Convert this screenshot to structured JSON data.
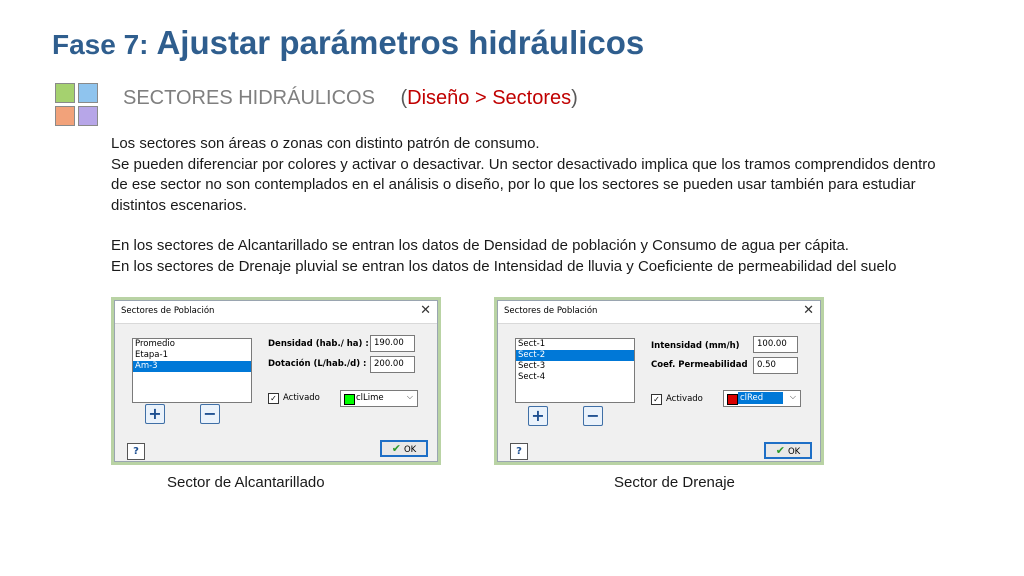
{
  "slide": {
    "title_prefix": "Fase 7:",
    "title_main": "Ajustar parámetros hidráulicos",
    "section_label": "SECTORES HIDRÁULICOS",
    "path_open": "(",
    "menu_path": "Diseño > Sectores",
    "path_close": ")",
    "paragraphs": [
      "Los sectores son áreas o zonas con distinto patrón de consumo.",
      "Se pueden diferenciar por colores y activar o desactivar. Un sector desactivado implica que los tramos comprendidos dentro de ese sector no son contemplados en el análisis o diseño, por lo que los sectores se pueden usar también para estudiar distintos escenarios.",
      "En los sectores de Alcantarillado se entran los datos de  Densidad de población y Consumo de agua per cápita.",
      "En los sectores de Drenaje pluvial se entran los datos de Intensidad de lluvia y Coeficiente de permeabilidad del suelo"
    ]
  },
  "dialogs": [
    {
      "title": "Sectores de Población",
      "close_glyph": "✕",
      "items": [
        "Promedio",
        "Etapa-1",
        "Am-3"
      ],
      "selected_index": 2,
      "field1_label": "Densidad  (hab./ ha) :",
      "field1_value": "190.00",
      "field2_label": "Dotación  (L/hab./d) :",
      "field2_value": "200.00",
      "activado_label": "Activado",
      "activado_checked": true,
      "check_glyph": "✓",
      "color_name": "clLime",
      "color_hex": "#00ff00",
      "dropdown_glyph": "⌵",
      "add_glyph": "+",
      "remove_glyph": "−",
      "help_glyph": "?",
      "ok_icon": "✔",
      "ok_label": "OK",
      "caption": "Sector de Alcantarillado"
    },
    {
      "title": "Sectores de Población",
      "close_glyph": "✕",
      "items": [
        "Sect-1",
        "Sect-2",
        "Sect-3",
        "Sect-4"
      ],
      "selected_index": 1,
      "field1_label": "Intensidad (mm/h)",
      "field1_value": "100.00",
      "field2_label": "Coef. Permeabilidad",
      "field2_value": "0.50",
      "activado_label": "Activado",
      "activado_checked": true,
      "check_glyph": "✓",
      "color_name": "clRed",
      "color_hex": "#d90000",
      "dropdown_glyph": "⌵",
      "add_glyph": "+",
      "remove_glyph": "−",
      "help_glyph": "?",
      "ok_icon": "✔",
      "ok_label": "OK",
      "caption": "Sector de Drenaje"
    }
  ],
  "colors": {
    "title": "#2f5e8e",
    "menu_path": "#c00000",
    "selection": "#0078d7",
    "frame": "#b9d3a4"
  }
}
